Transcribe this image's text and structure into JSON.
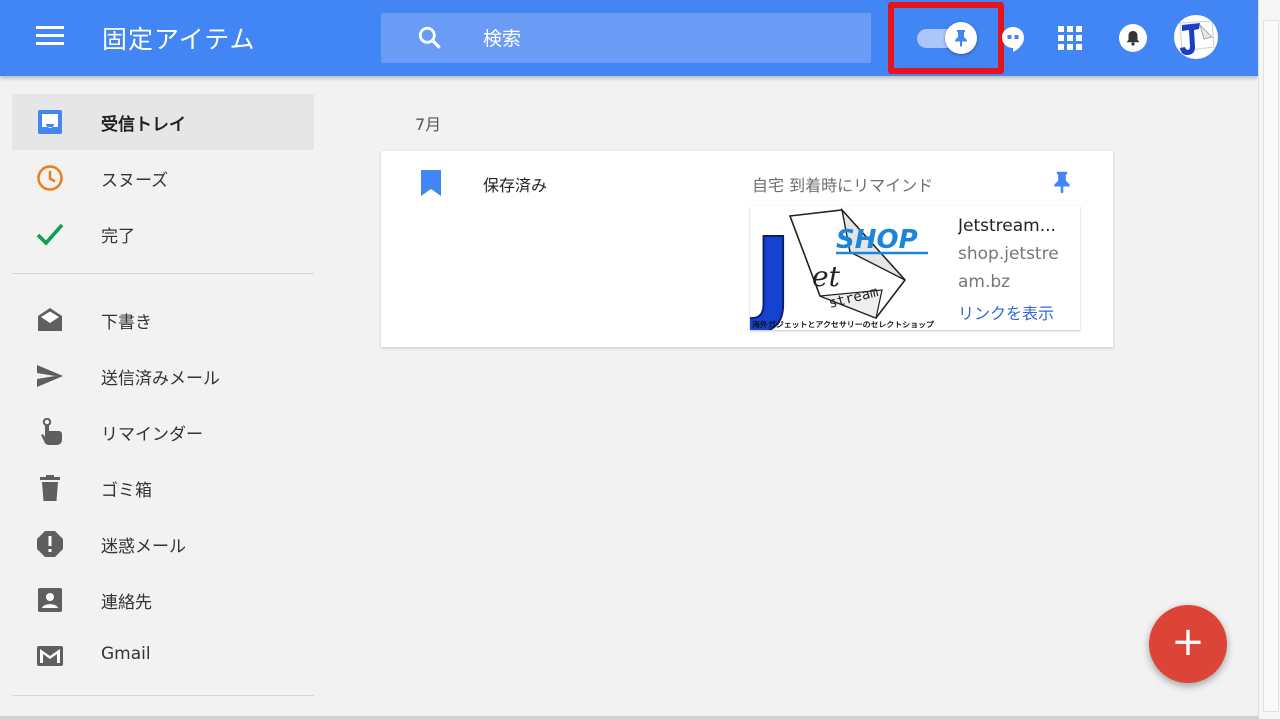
{
  "header": {
    "title": "固定アイテム",
    "search_placeholder": "検索"
  },
  "sidebar": {
    "items": [
      {
        "label": "受信トレイ",
        "icon": "inbox-icon"
      },
      {
        "label": "スヌーズ",
        "icon": "clock-icon"
      },
      {
        "label": "完了",
        "icon": "check-icon"
      },
      {
        "label": "下書き",
        "icon": "drafts-icon"
      },
      {
        "label": "送信済みメール",
        "icon": "send-icon"
      },
      {
        "label": "リマインダー",
        "icon": "reminder-icon"
      },
      {
        "label": "ゴミ箱",
        "icon": "trash-icon"
      },
      {
        "label": "迷惑メール",
        "icon": "spam-icon"
      },
      {
        "label": "連絡先",
        "icon": "contacts-icon"
      },
      {
        "label": "Gmail",
        "icon": "gmail-icon"
      }
    ]
  },
  "main": {
    "month": "7月",
    "card": {
      "subject": "保存済み",
      "reminder": "自宅 到着時にリマインド",
      "preview": {
        "title": "Jetstream...",
        "domain_line1": "shop.jetstre",
        "domain_line2": "am.bz",
        "link_label": "リンクを表示",
        "thumb_word": "SHOP",
        "thumb_letter": "J",
        "thumb_et": "et",
        "thumb_stream": "stream",
        "thumb_caption": "海外ガジェットとアクセサリーのセレクトショップ"
      }
    }
  },
  "fab": {
    "label": "+"
  },
  "colors": {
    "header": "#4285f4",
    "fab": "#db4437",
    "highlight": "#e8121b",
    "pin": "#4285f4",
    "link": "#3367d6"
  }
}
